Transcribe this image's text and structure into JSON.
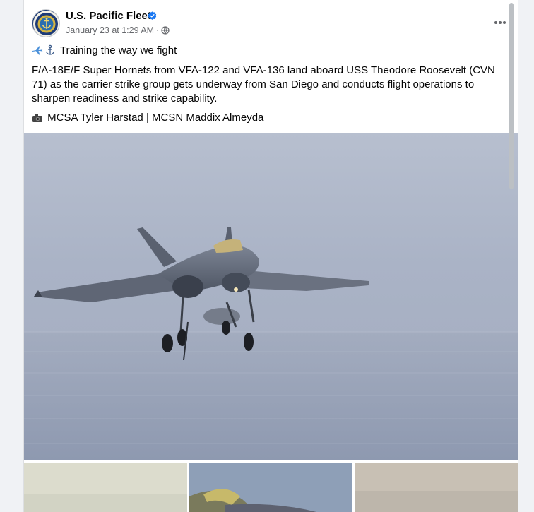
{
  "post": {
    "page_name": "U.S. Pacific Fleet",
    "verified": true,
    "timestamp": "January 23 at 1:29 AM",
    "separator": "·",
    "privacy_icon": "globe-icon",
    "more_icon": "more-dots-icon",
    "title_emojis": [
      "airplane-icon",
      "anchor-icon"
    ],
    "title": "Training the way we fight",
    "body": "F/A-18E/F Super Hornets from VFA-122 and VFA-136 land aboard USS Theodore Roosevelt (CVN 71) as the carrier strike group gets underway from San Diego and conducts flight operations to sharpen readiness and strike capability.",
    "credit_icon": "camera-icon",
    "credit": "MCSA Tyler Harstad | MCSN Maddix Almeyda"
  },
  "photos": {
    "main": "fa-18-super-hornet-landing-photo",
    "thumbnails": [
      "thumbnail-1-photo",
      "thumbnail-2-photo",
      "thumbnail-3-photo"
    ]
  },
  "colors": {
    "verified_blue": "#1877f2",
    "secondary_text": "#65676b",
    "primary_text": "#050505"
  }
}
